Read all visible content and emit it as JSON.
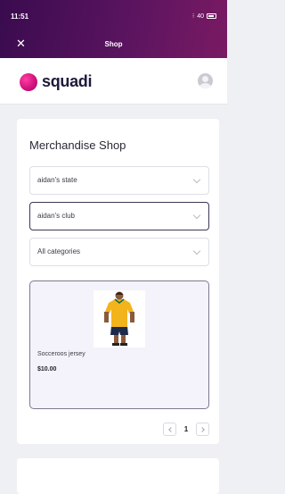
{
  "status": {
    "time": "11:51",
    "signal": "40"
  },
  "header": {
    "title": "Shop",
    "close_icon": "close-icon"
  },
  "brand": {
    "name": "squadi",
    "color": "#d3127d",
    "logo_icon": "squadi-logo-icon",
    "avatar_icon": "user-avatar-icon"
  },
  "shop": {
    "title": "Merchandise Shop",
    "filters": {
      "state": "aidan's state",
      "club": "aidan's club",
      "category": "All categories"
    },
    "products": [
      {
        "name": "Socceroos jersey",
        "price": "$10.00",
        "image_icon": "yellow-jersey-image"
      }
    ],
    "pagination": {
      "current": "1"
    }
  },
  "colors": {
    "header_start": "#3a0b4f",
    "header_end": "#7a1a63",
    "accent": "#3e3857"
  }
}
